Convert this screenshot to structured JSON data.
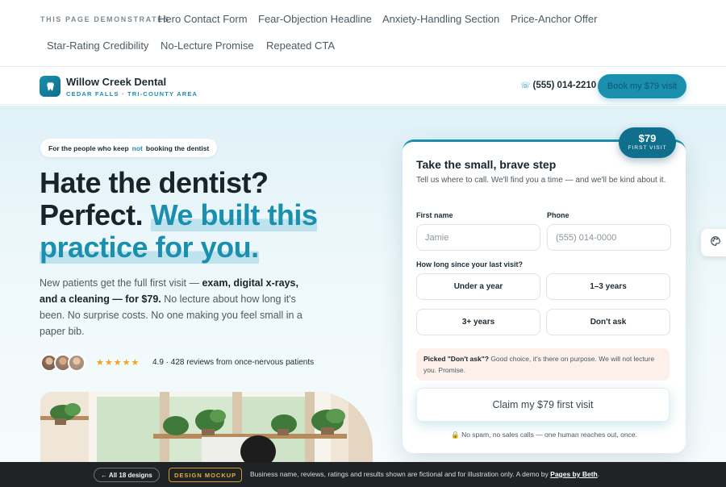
{
  "demo_strip": {
    "label": "THIS PAGE DEMONSTRATES",
    "items": [
      "Hero Contact Form",
      "Fear-Objection Headline",
      "Anxiety-Handling Section",
      "Price-Anchor Offer",
      "Star-Rating Credibility",
      "No-Lecture Promise",
      "Repeated CTA"
    ]
  },
  "header": {
    "brand_name": "Willow Creek Dental",
    "brand_sub": "CEDAR FALLS · TRI-COUNTY AREA",
    "logo_icon": "tooth-icon",
    "phone": "(555) 014-2210",
    "phone_icon": "phone-icon",
    "book_label": "Book my $79 visit"
  },
  "hero": {
    "eyebrow_pre": "For the people who keep",
    "eyebrow_accent": "not",
    "eyebrow_post": "booking the dentist",
    "headline_1": "Hate the dentist?",
    "headline_2": "Perfect.",
    "headline_accent": "We built this practice for you.",
    "lede_pre": "New patients get the full first visit —",
    "lede_bold": "exam, digital x-rays, and a cleaning — for $79.",
    "lede_post": "No lecture about how long it's been. No surprise costs. No one making you feel small in a paper bib.",
    "stars": "★★★★★",
    "rating_value": 4.9,
    "rating_text": "4.9 · 428 reviews from once-nervous patients"
  },
  "form": {
    "badge_price": "$79",
    "badge_sub": "FIRST VISIT",
    "title": "Take the small, brave step",
    "subtitle": "Tell us where to call. We'll find you a time — and we'll be kind about it.",
    "first_name_label": "First name",
    "first_name_placeholder": "Jamie",
    "phone_label": "Phone",
    "phone_placeholder": "(555) 014-0000",
    "last_visit_label": "How long since your last visit?",
    "options": [
      "Under a year",
      "1–3 years",
      "3+ years",
      "Don't ask"
    ],
    "note_bold": "Picked \"Don't ask\"?",
    "note_text": "Good choice, it's there on purpose. We will not lecture you. Promise.",
    "submit_label": "Claim my $79 first visit",
    "fine_print": "No spam, no sales calls — one human reaches out, once.",
    "lock_icon": "lock-icon"
  },
  "palette_icon": "palette-icon",
  "bottom_bar": {
    "back_label": "← All 18 designs",
    "badge": "DESIGN MOCKUP",
    "disclaimer": "Business name, reviews, ratings and results shown are fictional and for illustration only. A demo by",
    "by": "Pages by Beth",
    "period": "."
  },
  "colors": {
    "accent": "#1a8fae",
    "accent_dark": "#0f6f8c",
    "star": "#f2a21b",
    "note_bg": "#fdf0ea",
    "bar_bg": "#1f2326"
  }
}
